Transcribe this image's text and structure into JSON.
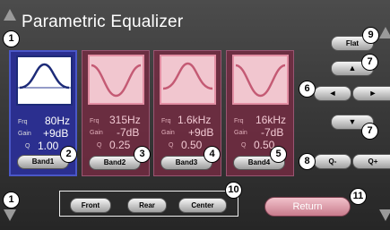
{
  "title": "Parametric Equalizer",
  "labels": {
    "frq": "Frq",
    "gain": "Gain",
    "q": "Q"
  },
  "bands": [
    {
      "frequency": "80Hz",
      "gain": "+9dB",
      "q": "1.00",
      "button": "Band1",
      "shape": "peak",
      "selected": true
    },
    {
      "frequency": "315Hz",
      "gain": "-7dB",
      "q": "0.25",
      "button": "Band2",
      "shape": "dip",
      "selected": false
    },
    {
      "frequency": "1.6kHz",
      "gain": "+9dB",
      "q": "0.50",
      "button": "Band3",
      "shape": "peak",
      "selected": false
    },
    {
      "frequency": "16kHz",
      "gain": "-7dB",
      "q": "0.50",
      "button": "Band4",
      "shape": "dip",
      "selected": false
    }
  ],
  "controls": {
    "flat": "Flat",
    "q_minus": "Q-",
    "q_plus": "Q+",
    "up_arrow": "▲",
    "down_arrow": "▼",
    "left_arrow": "◄",
    "right_arrow": "►"
  },
  "speakers": [
    "Front",
    "Rear",
    "Center"
  ],
  "return_label": "Return",
  "callouts": {
    "c1a": "1",
    "c1b": "1",
    "c2": "2",
    "c3": "3",
    "c4": "4",
    "c5": "5",
    "c6": "6",
    "c7a": "7",
    "c7b": "7",
    "c8": "8",
    "c9": "9",
    "c10": "10",
    "c11": "11"
  },
  "colors": {
    "selected_band": "#2b2f8f",
    "unselected_band": "#782a42",
    "return_button": "#d88f9f"
  }
}
